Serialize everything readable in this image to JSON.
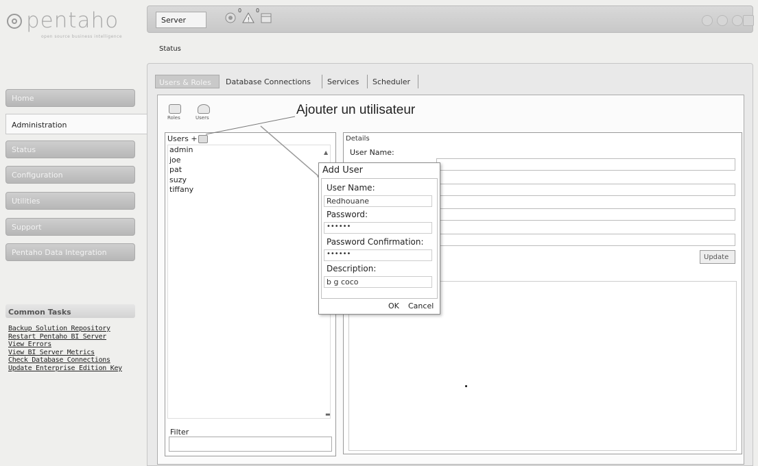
{
  "logo": {
    "text": "pentaho",
    "tagline": "open source business intelligence"
  },
  "topbar": {
    "server_label": "Server",
    "badge_count_1": "0",
    "badge_count_2": "0",
    "page_title": "Status"
  },
  "nav": {
    "items": [
      "Home",
      "Administration",
      "Status",
      "Configuration",
      "Utilities",
      "Support",
      "Pentaho Data Integration"
    ]
  },
  "common_tasks": {
    "title": "Common Tasks",
    "items": [
      "Backup Solution Repository",
      "Restart Pentaho BI Server",
      "View Errors",
      "View BI Server Metrics",
      "Check Database Connections",
      "Update Enterprise Edition Key"
    ]
  },
  "tabs": [
    "Users & Roles",
    "Database Connections",
    "Services",
    "Scheduler"
  ],
  "toolbar": {
    "roles_label": "Roles",
    "users_label": "Users"
  },
  "callout": "Ajouter un utilisateur",
  "users": {
    "header": "Users",
    "add_symbol": "+",
    "list": [
      "admin",
      "joe",
      "pat",
      "suzy",
      "tiffany"
    ],
    "filter_label": "Filter"
  },
  "details": {
    "title": "Details",
    "user_name_label": "User Name:",
    "update_label": "Update"
  },
  "dialog": {
    "title": "Add User",
    "user_name_label": "User Name:",
    "user_name_value": "Redhouane",
    "password_label": "Password:",
    "password_value": "••••••",
    "confirm_label": "Password Confirmation:",
    "confirm_value": "••••••",
    "description_label": "Description:",
    "description_value": "b g coco",
    "ok_label": "OK",
    "cancel_label": "Cancel"
  }
}
